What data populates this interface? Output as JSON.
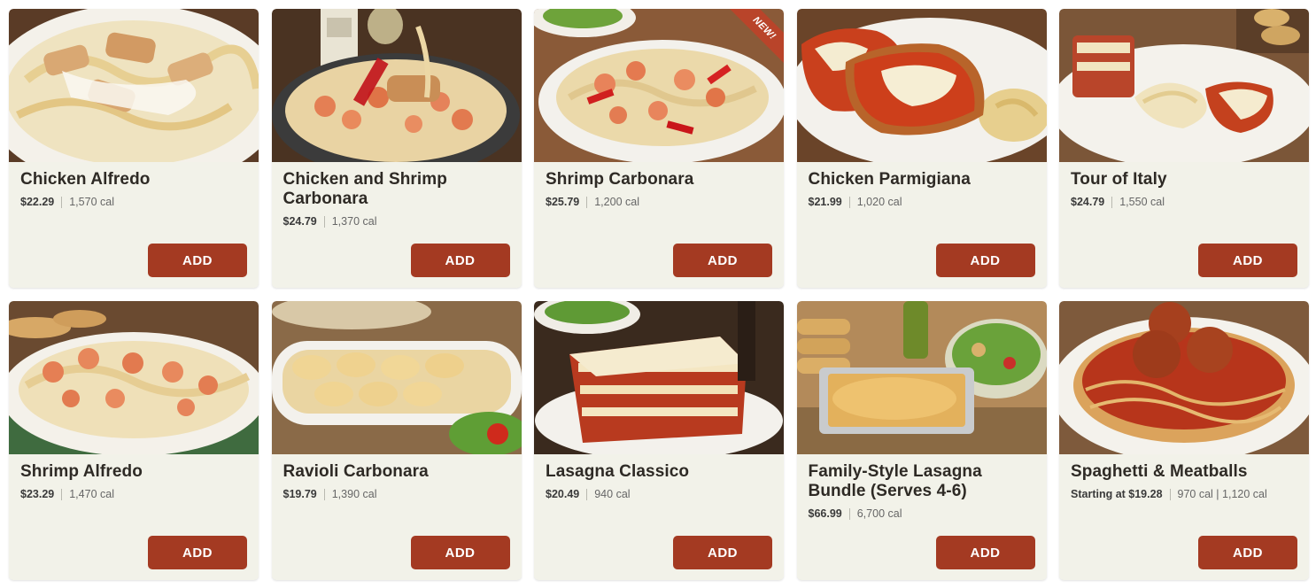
{
  "colors": {
    "card_bg": "#f2f2e9",
    "add_button": "#a43a22",
    "ribbon": "#b9442a"
  },
  "items": [
    {
      "name": "Chicken Alfredo",
      "price": "$22.29",
      "calories": "1,570 cal",
      "button": "ADD",
      "badge": ""
    },
    {
      "name": "Chicken and Shrimp Carbonara",
      "price": "$24.79",
      "calories": "1,370 cal",
      "button": "ADD",
      "badge": ""
    },
    {
      "name": "Shrimp Carbonara",
      "price": "$25.79",
      "calories": "1,200 cal",
      "button": "ADD",
      "badge": "NEW!"
    },
    {
      "name": "Chicken Parmigiana",
      "price": "$21.99",
      "calories": "1,020 cal",
      "button": "ADD",
      "badge": ""
    },
    {
      "name": "Tour of Italy",
      "price": "$24.79",
      "calories": "1,550 cal",
      "button": "ADD",
      "badge": ""
    },
    {
      "name": "Shrimp Alfredo",
      "price": "$23.29",
      "calories": "1,470 cal",
      "button": "ADD",
      "badge": ""
    },
    {
      "name": "Ravioli Carbonara",
      "price": "$19.79",
      "calories": "1,390 cal",
      "button": "ADD",
      "badge": ""
    },
    {
      "name": "Lasagna Classico",
      "price": "$20.49",
      "calories": "940 cal",
      "button": "ADD",
      "badge": ""
    },
    {
      "name": "Family-Style Lasagna Bundle (Serves 4-6)",
      "price": "$66.99",
      "calories": "6,700 cal",
      "button": "ADD",
      "badge": ""
    },
    {
      "name": "Spaghetti & Meatballs",
      "price": "Starting at $19.28",
      "calories": "970 cal | 1,120 cal",
      "button": "ADD",
      "badge": ""
    }
  ]
}
